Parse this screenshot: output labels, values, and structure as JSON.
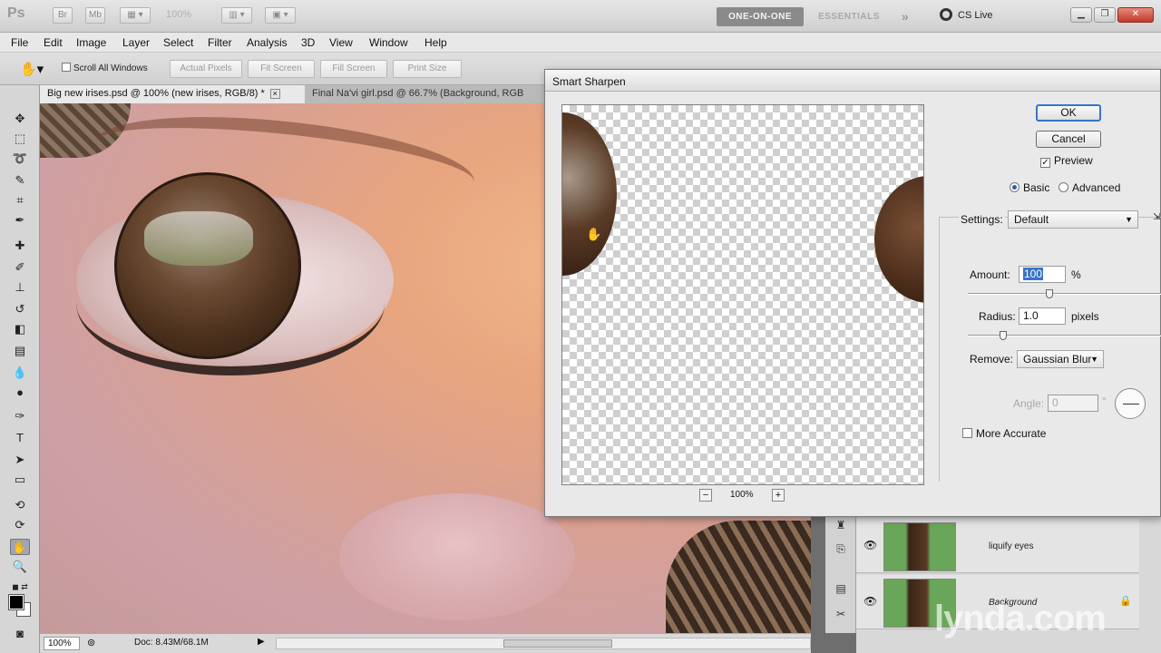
{
  "app": {
    "logo": "Ps",
    "toolbar_buttons": [
      "Br",
      "Mb"
    ],
    "zoom_display": "100%",
    "workspaces": [
      {
        "label": "ONE-ON-ONE",
        "active": true
      },
      {
        "label": "ESSENTIALS",
        "active": false
      }
    ],
    "overflow": "»",
    "cs_live": "CS Live"
  },
  "menu": [
    "File",
    "Edit",
    "Image",
    "Layer",
    "Select",
    "Filter",
    "Analysis",
    "3D",
    "View",
    "Window",
    "Help"
  ],
  "options_bar": {
    "scroll_all_windows": "Scroll All Windows",
    "buttons": [
      "Actual Pixels",
      "Fit Screen",
      "Fill Screen",
      "Print Size"
    ]
  },
  "tabs": [
    {
      "label": "Big new irises.psd @ 100% (new irises, RGB/8) *",
      "active": true
    },
    {
      "label": "Final Na'vi girl.psd @ 66.7% (Background, RGB",
      "active": false
    }
  ],
  "status": {
    "zoom": "100%",
    "doc": "Doc: 8.43M/68.1M"
  },
  "layers": [
    {
      "name": "liquify eyes",
      "italic": false
    },
    {
      "name": "Background",
      "italic": true
    }
  ],
  "watermark": "lynda.com",
  "dialog": {
    "title": "Smart Sharpen",
    "ok": "OK",
    "cancel": "Cancel",
    "preview_label": "Preview",
    "preview_checked": true,
    "basic_label": "Basic",
    "advanced_label": "Advanced",
    "mode": "Basic",
    "settings_label": "Settings:",
    "settings_value": "Default",
    "amount_label": "Amount:",
    "amount_value": "100",
    "amount_unit": "%",
    "amount_level": 0.42,
    "radius_label": "Radius:",
    "radius_value": "1.0",
    "radius_unit": "pixels",
    "radius_level": 0.18,
    "remove_label": "Remove:",
    "remove_value": "Gaussian Blur",
    "angle_label": "Angle:",
    "angle_value": "0",
    "angle_unit": "°",
    "more_accurate": "More Accurate",
    "preview_zoom": "100%"
  }
}
